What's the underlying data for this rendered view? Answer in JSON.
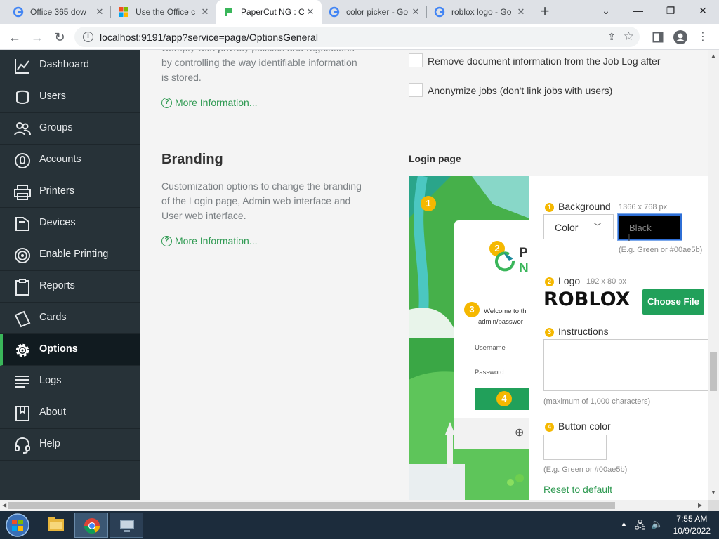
{
  "browser": {
    "tabs": [
      {
        "title": "Office 365 dow",
        "favicon": "google-icon"
      },
      {
        "title": "Use the Office c",
        "favicon": "microsoft-icon"
      },
      {
        "title": "PaperCut NG : C",
        "favicon": "papercut-icon"
      },
      {
        "title": "color picker - Go",
        "favicon": "google-icon"
      },
      {
        "title": "roblox logo - Go",
        "favicon": "google-icon"
      }
    ],
    "url": "localhost:9191/app?service=page/OptionsGeneral"
  },
  "sidebar": {
    "items": [
      {
        "label": "Dashboard",
        "icon": "chart-icon"
      },
      {
        "label": "Users",
        "icon": "user-icon"
      },
      {
        "label": "Groups",
        "icon": "group-icon"
      },
      {
        "label": "Accounts",
        "icon": "piggybank-icon"
      },
      {
        "label": "Printers",
        "icon": "printer-icon"
      },
      {
        "label": "Devices",
        "icon": "device-icon"
      },
      {
        "label": "Enable Printing",
        "icon": "fingerprint-icon"
      },
      {
        "label": "Reports",
        "icon": "clipboard-icon"
      },
      {
        "label": "Cards",
        "icon": "card-icon"
      },
      {
        "label": "Options",
        "icon": "gear-icon"
      },
      {
        "label": "Logs",
        "icon": "list-icon"
      },
      {
        "label": "About",
        "icon": "book-icon"
      },
      {
        "label": "Help",
        "icon": "headset-icon"
      }
    ],
    "active": "Options"
  },
  "privacy": {
    "desc_lines": [
      "Comply with privacy policies and regulations",
      "by controlling the way identifiable information",
      "is stored."
    ],
    "more_info": "More Information...",
    "options": [
      "Remove document information from the Job Log after",
      "Anonymize jobs (don't link jobs with users)"
    ]
  },
  "branding": {
    "title": "Branding",
    "desc_lines": [
      "Customization options to change the branding",
      "of the Login page, Admin web interface and",
      "User web interface."
    ],
    "more_info": "More Information...",
    "login_page_label": "Login page",
    "preview": {
      "badges": [
        "1",
        "2",
        "3",
        "4"
      ],
      "logo_text_top": "P",
      "logo_text_bottom": "N",
      "welcome_line1": "Welcome to th",
      "welcome_line2": "admin/passwor",
      "username_label": "Username",
      "password_label": "Password"
    },
    "background": {
      "num": "1",
      "label": "Background",
      "size": "1366 x 768 px",
      "select_value": "Color",
      "color_value": "Black",
      "hint": "(E.g. Green or #00ae5b)"
    },
    "logo": {
      "num": "2",
      "label": "Logo",
      "size": "192 x 80 px",
      "logo_text": "ROBLOX",
      "choose_file": "Choose File"
    },
    "instructions": {
      "num": "3",
      "label": "Instructions",
      "hint": "(maximum of 1,000 characters)"
    },
    "button_color": {
      "num": "4",
      "label": "Button color",
      "hint": "(E.g. Green or #00ae5b)"
    },
    "reset": "Reset to default"
  },
  "taskbar": {
    "time": "7:55 AM",
    "date": "10/9/2022"
  },
  "colors": {
    "sidebar_bg": "#273238",
    "accent_green": "#2f9a52",
    "badge_yellow": "#f5b800"
  }
}
